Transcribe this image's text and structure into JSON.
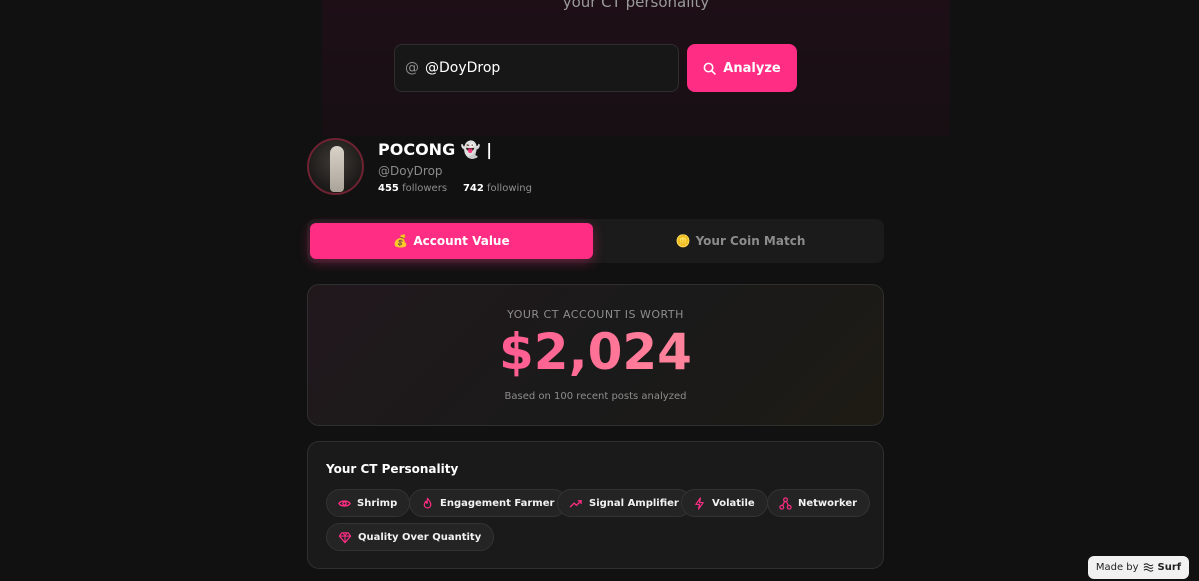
{
  "hero": {
    "subtitle": "your CT personality",
    "search_prefix": "@",
    "search_value": "@DoyDrop",
    "analyze_label": "Analyze"
  },
  "profile": {
    "name": "POCONG 👻 |",
    "handle": "@DoyDrop",
    "followers_count": "455",
    "followers_label": "followers",
    "following_count": "742",
    "following_label": "following"
  },
  "tabs": [
    {
      "emoji": "💰",
      "label": "Account Value",
      "active": true
    },
    {
      "emoji": "🪙",
      "label": "Your Coin Match",
      "active": false
    }
  ],
  "worth": {
    "label": "YOUR CT ACCOUNT IS WORTH",
    "value": "$2,024",
    "note": "Based on 100 recent posts analyzed"
  },
  "personality": {
    "title": "Your CT Personality",
    "traits": [
      {
        "label": "Shrimp",
        "icon": "eye-icon"
      },
      {
        "label": "Engagement Farmer",
        "icon": "flame-icon"
      },
      {
        "label": "Signal Amplifier",
        "icon": "trending-up-icon"
      },
      {
        "label": "Volatile",
        "icon": "lightning-icon"
      },
      {
        "label": "Networker",
        "icon": "network-icon"
      },
      {
        "label": "Quality Over Quantity",
        "icon": "diamond-icon"
      }
    ]
  },
  "footer": {
    "made_by": "Made by",
    "brand": "Surf"
  },
  "colors": {
    "accent": "#ff2d84",
    "background": "#111111",
    "card": "#1a1a1a"
  }
}
